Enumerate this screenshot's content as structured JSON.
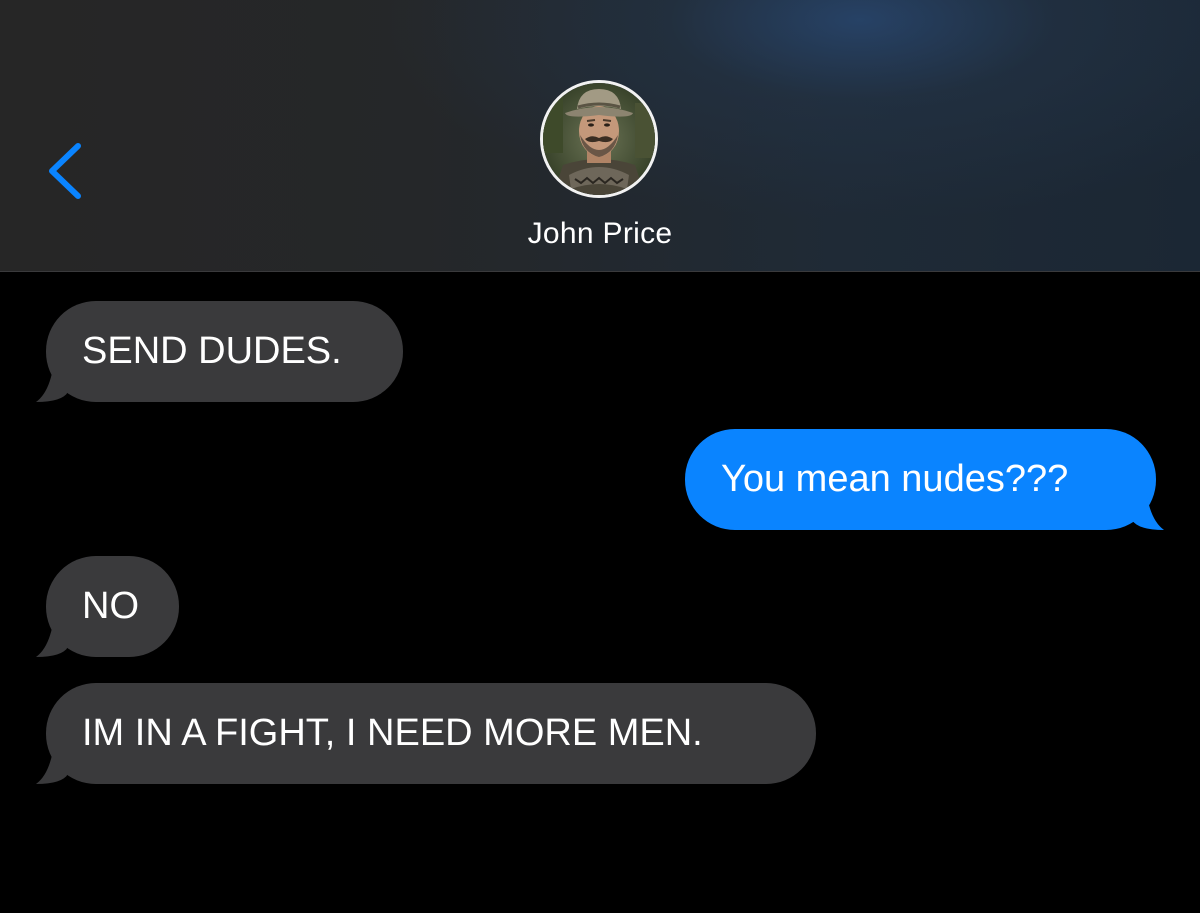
{
  "header": {
    "contact_name": "John Price",
    "back_icon": "chevron-left-icon",
    "avatar_icon": "contact-avatar-photo"
  },
  "colors": {
    "accent": "#0a84ff",
    "incoming_bubble": "#3a3a3c",
    "outgoing_bubble": "#0a84ff",
    "background": "#000000"
  },
  "messages": [
    {
      "direction": "incoming",
      "text": "SEND DUDES."
    },
    {
      "direction": "outgoing",
      "text": "You mean nudes???"
    },
    {
      "direction": "incoming",
      "text": "NO"
    },
    {
      "direction": "incoming",
      "text": "IM IN A FIGHT, I NEED MORE MEN."
    }
  ]
}
